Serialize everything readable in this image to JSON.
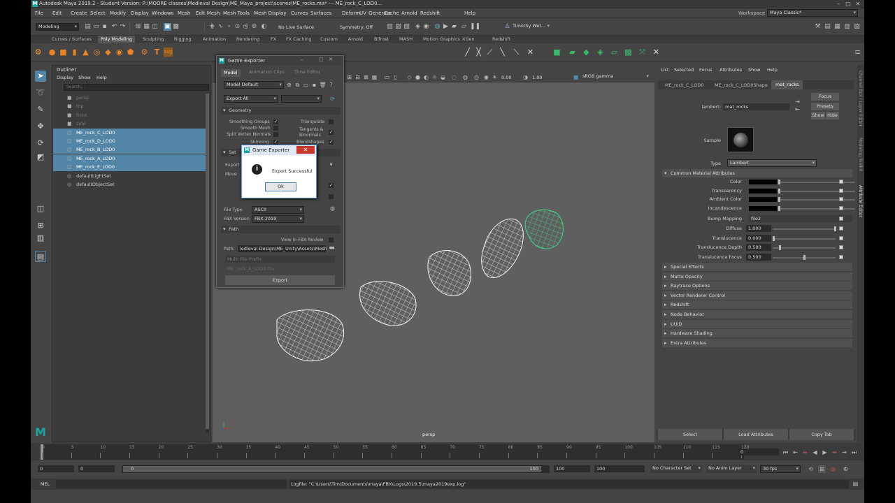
{
  "window": {
    "title": "Autodesk Maya 2019.2 - Student Version: P:\\MOORE classes\\Medieval Design\\ME_Maya_project\\scenes\\ME_rocks.ma* --- ME_rock_C_LOD0...",
    "workspace_label": "Workspace :",
    "workspace_value": "Maya Classic*"
  },
  "menus": [
    "File",
    "Edit",
    "Create",
    "Select",
    "Modify",
    "Display",
    "Windows",
    "Mesh",
    "Edit Mesh",
    "Mesh Tools",
    "Mesh Display",
    "Curves",
    "Surfaces",
    "Deform",
    "UV",
    "Generate",
    "Cache",
    "Arnold",
    "Redshift",
    "Help"
  ],
  "status": {
    "menuset": "Modeling",
    "live_surface": "No Live Surface",
    "symmetry": "Symmetry: Off",
    "user": "Timothy Wet..."
  },
  "shelf_tabs": [
    "Curves / Surfaces",
    "Poly Modeling",
    "Sculpting",
    "Rigging",
    "Animation",
    "Rendering",
    "FX",
    "FX Caching",
    "Custom",
    "Arnold",
    "Bifrost",
    "MASH",
    "Motion Graphics",
    "XGen",
    "Redshift"
  ],
  "shelf_active": "Poly Modeling",
  "outliner": {
    "title": "Outliner",
    "menu": [
      "Display",
      "Show",
      "Help"
    ],
    "search_placeholder": "Search...",
    "items": [
      {
        "label": "persp",
        "icon": "camera-icon",
        "state": "dim"
      },
      {
        "label": "top",
        "icon": "camera-icon",
        "state": "dim"
      },
      {
        "label": "front",
        "icon": "camera-icon",
        "state": "dim"
      },
      {
        "label": "side",
        "icon": "camera-icon",
        "state": "dim"
      },
      {
        "label": "ME_rock_C_LOD0",
        "icon": "mesh-icon",
        "state": "sel"
      },
      {
        "label": "ME_rock_D_LOD0",
        "icon": "mesh-icon",
        "state": "sel"
      },
      {
        "label": "ME_rock_B_LOD0",
        "icon": "mesh-icon",
        "state": "sel"
      },
      {
        "label": "ME_rock_A_LOD0",
        "icon": "mesh-icon",
        "state": "sel"
      },
      {
        "label": "ME_rock_E_LOD0",
        "icon": "mesh-icon",
        "state": "sel"
      },
      {
        "label": "defaultLightSet",
        "icon": "set-icon",
        "state": ""
      },
      {
        "label": "defaultObjectSet",
        "icon": "set-icon",
        "state": ""
      }
    ]
  },
  "viewport": {
    "camera_label": "persp",
    "exposure": "0.00",
    "gamma": "1.00",
    "color_space": "sRGB gamma"
  },
  "game_exporter": {
    "title": "Game Exporter",
    "tabs": [
      "Model",
      "Animation Clips",
      "Time Editor"
    ],
    "preset": "Model Default",
    "export_mode": "Export All",
    "geometry_label": "Geometry",
    "geometry_options": [
      {
        "label": "Smoothing Groups",
        "checked": true
      },
      {
        "label": "Smooth Mesh",
        "checked": false
      },
      {
        "label": "Split Vertex Normals",
        "checked": false
      },
      {
        "label": "Skinning",
        "checked": true
      },
      {
        "label": "Triangulate",
        "checked": false
      },
      {
        "label": "Tangents & Binormals",
        "checked": true
      },
      {
        "label": "Blendshapes",
        "checked": true
      }
    ],
    "partial_labels": [
      "Set",
      "Export",
      "Move"
    ],
    "file_type_label": "File Type",
    "file_type": "ASCII",
    "fbx_version_label": "FBX Version",
    "fbx_version": "FBX 2019",
    "path_section": "Path",
    "view_fbx_label": "View in FBX Review",
    "path_label": "Path:",
    "path_value": "ledieval Design\\ME_Unity\\Assets\\Mesh",
    "multi_file_placeholder": "Multi File Prefix",
    "file_name": "ME_rock_A_LOD0.fbx",
    "export_button": "Export"
  },
  "dialog": {
    "title": "Game Exporter",
    "message": "Export Successful",
    "ok": "Ok",
    "close": "✕"
  },
  "attribute_editor": {
    "menu": [
      "List",
      "Selected",
      "Focus",
      "Attributes",
      "Show",
      "Help"
    ],
    "tabs": [
      "ME_rock_C_LOD0",
      "ME_rock_C_LOD0Shape",
      "mat_rocks"
    ],
    "active_tab": "mat_rocks",
    "node_type_label": "lambert:",
    "node_name": "mat_rocks",
    "focus": "Focus",
    "presets": "Presets",
    "show": "Show",
    "hide": "Hide",
    "sample_label": "Sample",
    "type_label": "Type",
    "type_value": "Lambert",
    "common_section": "Common Material Attributes",
    "color_attrs": [
      {
        "label": "Color",
        "level": 0.0
      },
      {
        "label": "Transparency",
        "level": 0.0
      },
      {
        "label": "Ambient Color",
        "level": 0.0
      },
      {
        "label": "Incandescence",
        "level": 0.0
      }
    ],
    "bump_label": "Bump Mapping",
    "bump_value": "file2",
    "num_attrs": [
      {
        "label": "Diffuse",
        "value": "1.000",
        "level": 1.0
      },
      {
        "label": "Translucence",
        "value": "0.000",
        "level": 0.0
      },
      {
        "label": "Translucence Depth",
        "value": "0.500",
        "level": 0.1
      },
      {
        "label": "Translucence Focus",
        "value": "0.500",
        "level": 0.5
      }
    ],
    "sections": [
      "Special Effects",
      "Matte Opacity",
      "Raytrace Options",
      "Vector Renderer Control",
      "Redshift",
      "Node Behavior",
      "UUID",
      "Hardware Shading",
      "Extra Attributes"
    ],
    "bottom_buttons": [
      "Select",
      "Load Attributes",
      "Copy Tab"
    ]
  },
  "side_tabs": [
    "Channel Box / Layer Editor",
    "Modeling Toolkit",
    "Attribute Editor"
  ],
  "timeline": {
    "ticks": [
      "0",
      "5",
      "10",
      "15",
      "20",
      "25",
      "30",
      "35",
      "40",
      "45",
      "50",
      "55",
      "60",
      "65",
      "70",
      "75",
      "80",
      "85",
      "90",
      "95",
      "100",
      "105",
      "110",
      "115",
      "120"
    ],
    "current_frame": "0"
  },
  "range": {
    "start": "0",
    "play_start": "0",
    "range_start": "0",
    "range_end": "100",
    "play_end": "100",
    "end": "100",
    "character_set": "No Character Set",
    "anim_layer": "No Anim Layer",
    "fps": "30 fps"
  },
  "command": {
    "lang": "MEL",
    "log": "Logfile: \"C:\\Users\\Tim\\Documents\\maya\\FBX\\Logs\\2019.5\\maya2019exp.log\""
  }
}
